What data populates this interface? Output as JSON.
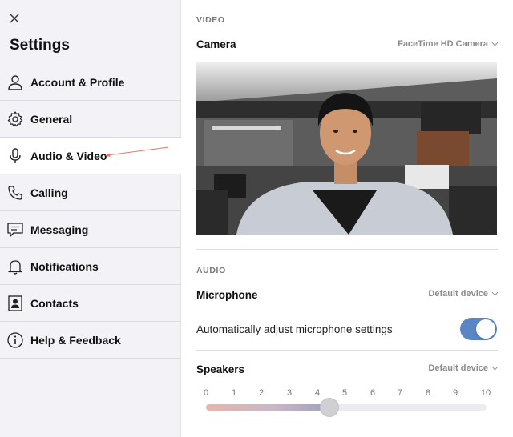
{
  "sidebar": {
    "title": "Settings",
    "close_icon": "close-icon",
    "items": [
      {
        "label": "Account & Profile",
        "icon": "person-icon",
        "active": false
      },
      {
        "label": "General",
        "icon": "gear-icon",
        "active": false
      },
      {
        "label": "Audio & Video",
        "icon": "microphone-icon",
        "active": true
      },
      {
        "label": "Calling",
        "icon": "phone-icon",
        "active": false
      },
      {
        "label": "Messaging",
        "icon": "message-icon",
        "active": false
      },
      {
        "label": "Notifications",
        "icon": "bell-icon",
        "active": false
      },
      {
        "label": "Contacts",
        "icon": "contacts-icon",
        "active": false
      },
      {
        "label": "Help & Feedback",
        "icon": "info-icon",
        "active": false
      }
    ]
  },
  "video": {
    "section_label": "VIDEO",
    "camera_label": "Camera",
    "camera_device": "FaceTime HD Camera"
  },
  "audio": {
    "section_label": "AUDIO",
    "microphone_label": "Microphone",
    "microphone_device": "Default device",
    "auto_adjust_label": "Automatically adjust microphone settings",
    "auto_adjust_enabled": true,
    "speakers_label": "Speakers",
    "speakers_device": "Default device",
    "volume_ticks": [
      "0",
      "1",
      "2",
      "3",
      "4",
      "5",
      "6",
      "7",
      "8",
      "9",
      "10"
    ],
    "volume_value": 4.4,
    "volume_max": 10
  },
  "colors": {
    "toggle_on": "#5a86c6",
    "annotation_arrow": "#e07a6a",
    "sidebar_bg": "#f2f2f7"
  }
}
